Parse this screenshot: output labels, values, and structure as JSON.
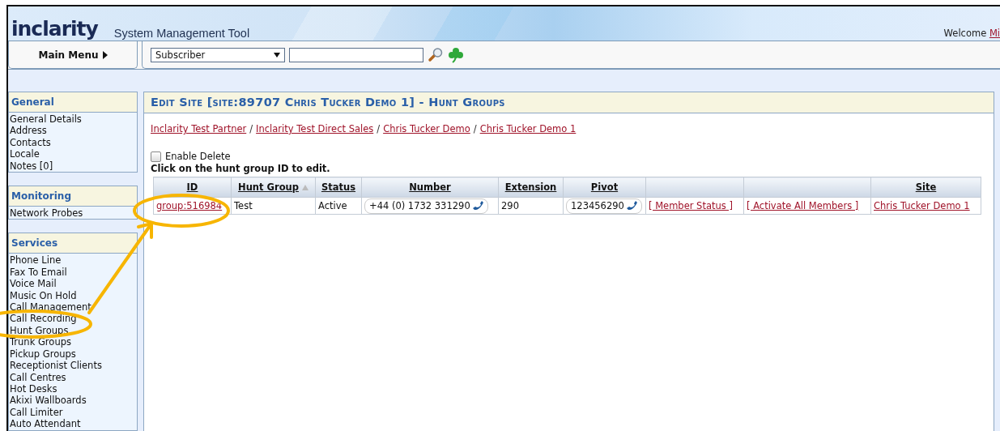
{
  "header": {
    "logo": "inclarity",
    "title": "System Management Tool",
    "welcome": "Welcome",
    "user_link": "Mi"
  },
  "menubar": {
    "main_menu": "Main Menu",
    "search_type": "Subscriber"
  },
  "sidebar": [
    {
      "heading": "General",
      "items": [
        "General Details",
        "Address",
        "Contacts",
        "Locale",
        "Notes [0]"
      ]
    },
    {
      "heading": "Monitoring",
      "items": [
        "Network Probes"
      ]
    },
    {
      "heading": "Services",
      "items": [
        "Phone Line",
        "Fax To Email",
        "Voice Mail",
        "Music On Hold",
        "Call Management",
        "Call Recording",
        "Hunt Groups",
        "Trunk Groups",
        "Pickup Groups",
        "Receptionist Clients",
        "Call Centres",
        "Hot Desks",
        "Akixi Wallboards",
        "Call Limiter",
        "Auto Attendant"
      ]
    }
  ],
  "page": {
    "title": "Edit Site [site:89707 Chris Tucker Demo 1] - Hunt Groups",
    "breadcrumb_separator": "/",
    "breadcrumbs": [
      "Inclarity Test Partner",
      "Inclarity Test Direct Sales",
      "Chris Tucker Demo",
      "Chris Tucker Demo 1"
    ],
    "enable_delete": {
      "label": "Enable Delete",
      "checked": false
    },
    "instruction": "Click on the hunt group ID to edit.",
    "table": {
      "columns": [
        {
          "label": "ID",
          "sorted": false
        },
        {
          "label": "Hunt Group",
          "sorted": true
        },
        {
          "label": "Status",
          "sorted": false
        },
        {
          "label": "Number",
          "sorted": false
        },
        {
          "label": "Extension",
          "sorted": false
        },
        {
          "label": "Pivot",
          "sorted": false
        },
        {
          "sorted": false
        },
        {
          "sorted": false
        },
        {
          "label": "Site",
          "sorted": false
        }
      ],
      "rows": [
        {
          "cells": [
            {
              "kind": "link",
              "text": "group:516984"
            },
            {
              "kind": "text",
              "text": "Test"
            },
            {
              "kind": "text",
              "text": "Active"
            },
            {
              "kind": "phone",
              "text": "+44 (0) 1732 331290"
            },
            {
              "kind": "text",
              "text": "290"
            },
            {
              "kind": "phone",
              "text": "123456290"
            },
            {
              "kind": "link",
              "text": "[ Member Status ]"
            },
            {
              "kind": "link",
              "text": "[ Activate All Members ]"
            },
            {
              "kind": "link",
              "text": "Chris Tucker Demo 1"
            }
          ]
        }
      ]
    }
  }
}
